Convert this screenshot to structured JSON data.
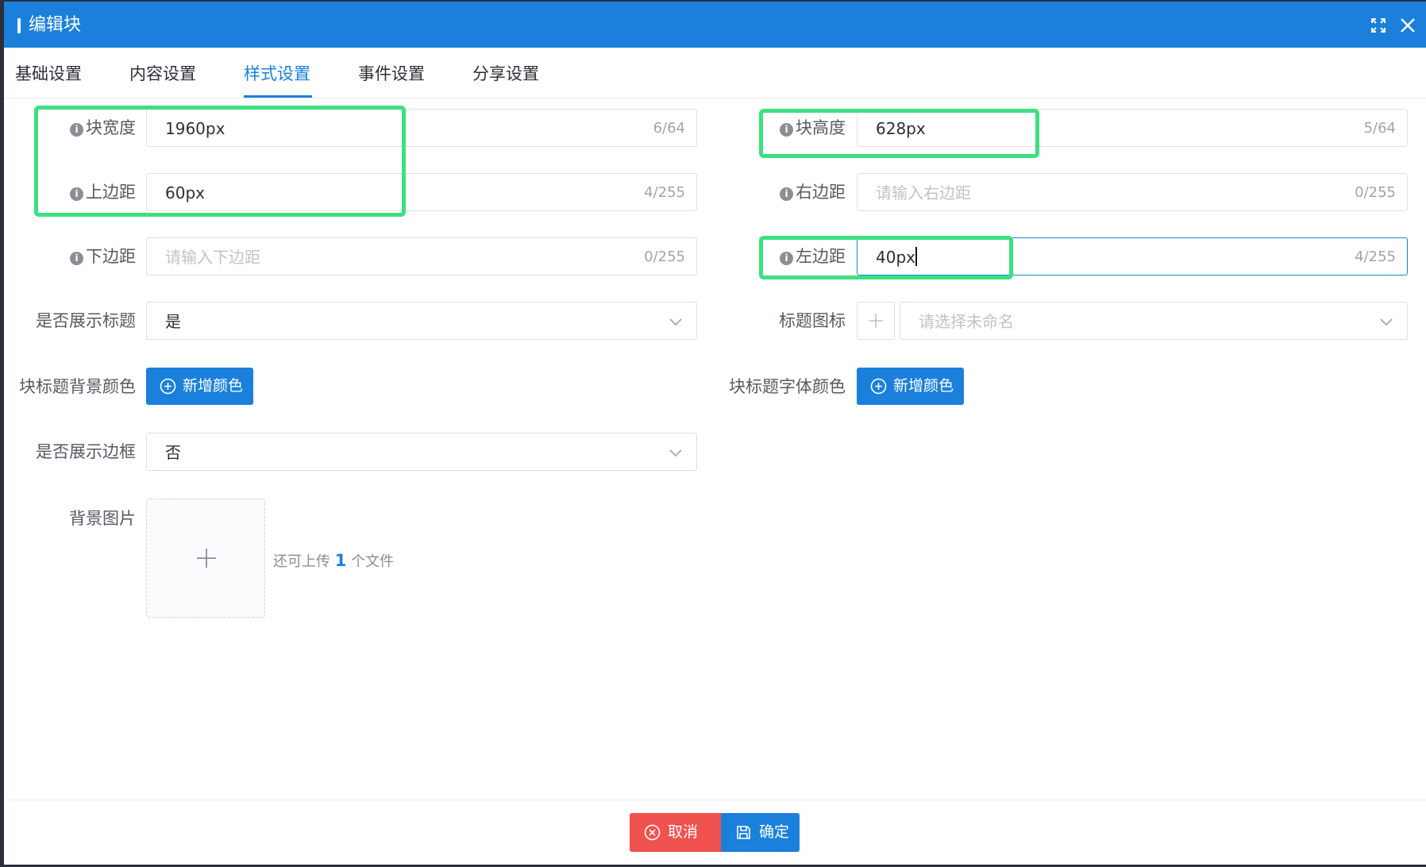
{
  "dialog": {
    "title": "编辑块"
  },
  "tabs": [
    "基础设置",
    "内容设置",
    "样式设置",
    "事件设置",
    "分享设置"
  ],
  "active_tab": "样式设置",
  "form": {
    "block_width": {
      "label": "块宽度",
      "value": "1960px",
      "count": "6/64"
    },
    "block_height": {
      "label": "块高度",
      "value": "628px",
      "count": "5/64"
    },
    "margin_top": {
      "label": "上边距",
      "value": "60px",
      "count": "4/255"
    },
    "margin_right": {
      "label": "右边距",
      "placeholder": "请输入右边距",
      "count": "0/255"
    },
    "margin_bottom": {
      "label": "下边距",
      "placeholder": "请输入下边距",
      "count": "0/255"
    },
    "margin_left": {
      "label": "左边距",
      "value": "40px",
      "count": "4/255"
    },
    "show_title": {
      "label": "是否展示标题",
      "value": "是"
    },
    "title_icon": {
      "label": "标题图标",
      "placeholder": "请选择未命名"
    },
    "title_bg_color": {
      "label": "块标题背景颜色",
      "button": "新增颜色"
    },
    "title_font_color": {
      "label": "块标题字体颜色",
      "button": "新增颜色"
    },
    "show_border": {
      "label": "是否展示边框",
      "value": "否"
    },
    "bg_image": {
      "label": "背景图片",
      "hint_before": "还可上传",
      "hint_count": "1",
      "hint_after": "个文件"
    }
  },
  "footer": {
    "cancel": "取消",
    "confirm": "确定"
  },
  "colors": {
    "primary": "#1b80dc",
    "danger": "#f0524f",
    "highlight": "#3ce07f"
  }
}
